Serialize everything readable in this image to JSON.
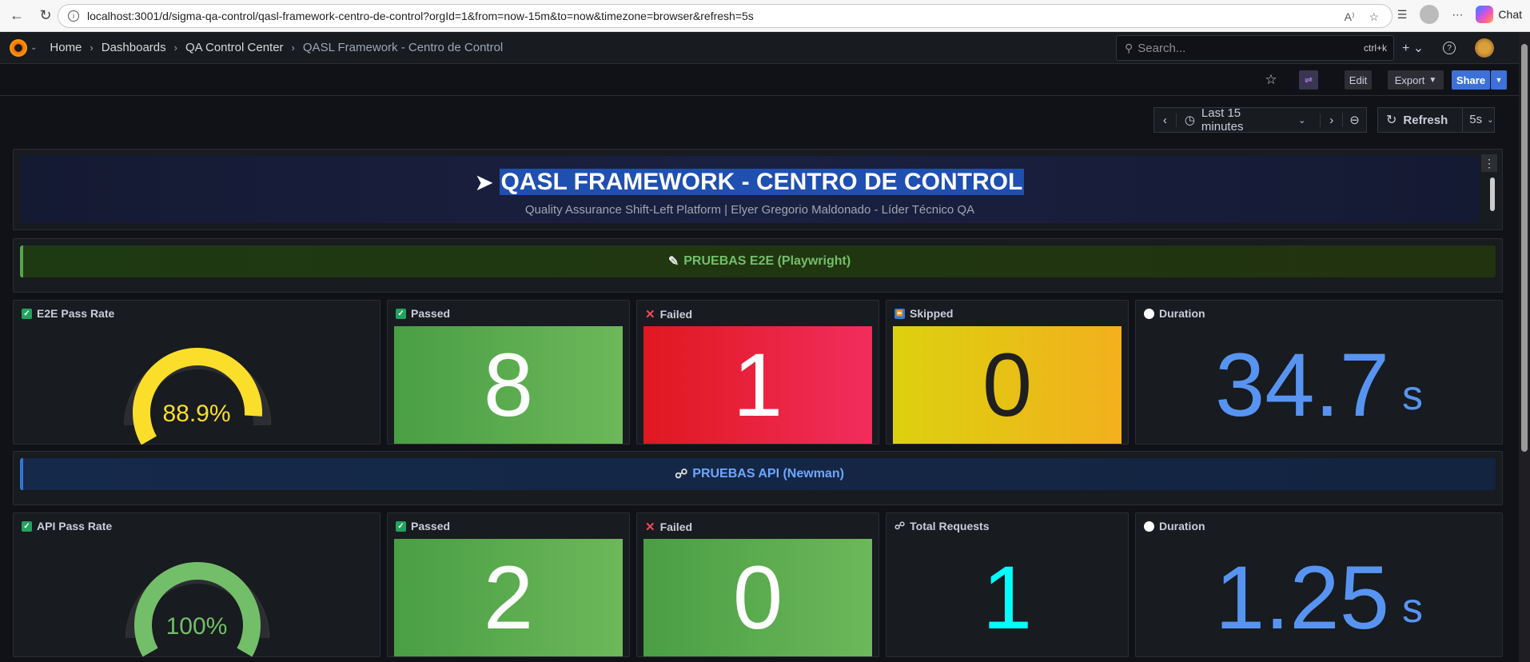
{
  "browser": {
    "url": "localhost:3001/d/sigma-qa-control/qasl-framework-centro-de-control?orgId=1&from=now-15m&to=now&timezone=browser&refresh=5s",
    "chat_label": "Chat"
  },
  "nav": {
    "breadcrumbs": [
      "Home",
      "Dashboards",
      "QA Control Center",
      "QASL Framework - Centro de Control"
    ],
    "search_placeholder": "Search...",
    "search_shortcut": "ctrl+k"
  },
  "toolbar": {
    "edit": "Edit",
    "export": "Export",
    "share": "Share",
    "time_range": "Last 15 minutes",
    "refresh": "Refresh",
    "refresh_interval": "5s"
  },
  "header_panel": {
    "title": "QASL FRAMEWORK - CENTRO DE CONTROL",
    "subtitle": "Quality Assurance Shift-Left Platform | Elyer Gregorio Maldonado - Líder Técnico QA"
  },
  "e2e": {
    "banner": "PRUEBAS E2E (Playwright)",
    "pass_rate": {
      "title": "E2E Pass Rate",
      "value": 88.9,
      "label": "88.9%"
    },
    "passed": {
      "title": "Passed",
      "value": "8"
    },
    "failed": {
      "title": "Failed",
      "value": "1"
    },
    "skipped": {
      "title": "Skipped",
      "value": "0"
    },
    "duration": {
      "title": "Duration",
      "value": "34.7",
      "unit": "s"
    }
  },
  "api": {
    "banner": "PRUEBAS API (Newman)",
    "pass_rate": {
      "title": "API Pass Rate",
      "value": 100,
      "label": "100%"
    },
    "passed": {
      "title": "Passed",
      "value": "2"
    },
    "failed": {
      "title": "Failed",
      "value": "0"
    },
    "total_requests": {
      "title": "Total Requests",
      "value": "1"
    },
    "duration": {
      "title": "Duration",
      "value": "1.25",
      "unit": "s"
    }
  },
  "colors": {
    "green": "#56a64b",
    "red": "#e02f44",
    "yellow": "#fade2a",
    "blue": "#5794f2",
    "cyan": "#00ffff",
    "share": "#3d71d9"
  }
}
